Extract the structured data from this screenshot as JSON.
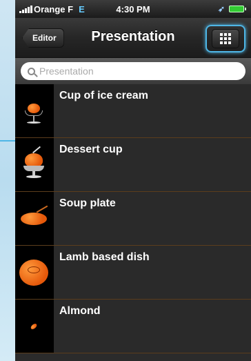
{
  "status_bar": {
    "carrier": "Orange F",
    "network": "E",
    "time": "4:30 PM"
  },
  "nav": {
    "back_label": "Editor",
    "title": "Presentation",
    "grid_icon": "grid-icon"
  },
  "search": {
    "placeholder": "Presentation"
  },
  "items": [
    {
      "label": "Cup of ice cream"
    },
    {
      "label": "Dessert cup"
    },
    {
      "label": "Soup plate"
    },
    {
      "label": "Lamb based dish"
    },
    {
      "label": "Almond"
    }
  ],
  "colors": {
    "accent": "#4eb6e6",
    "row_separator": "#5c3d1c",
    "food": "#e5580a"
  }
}
